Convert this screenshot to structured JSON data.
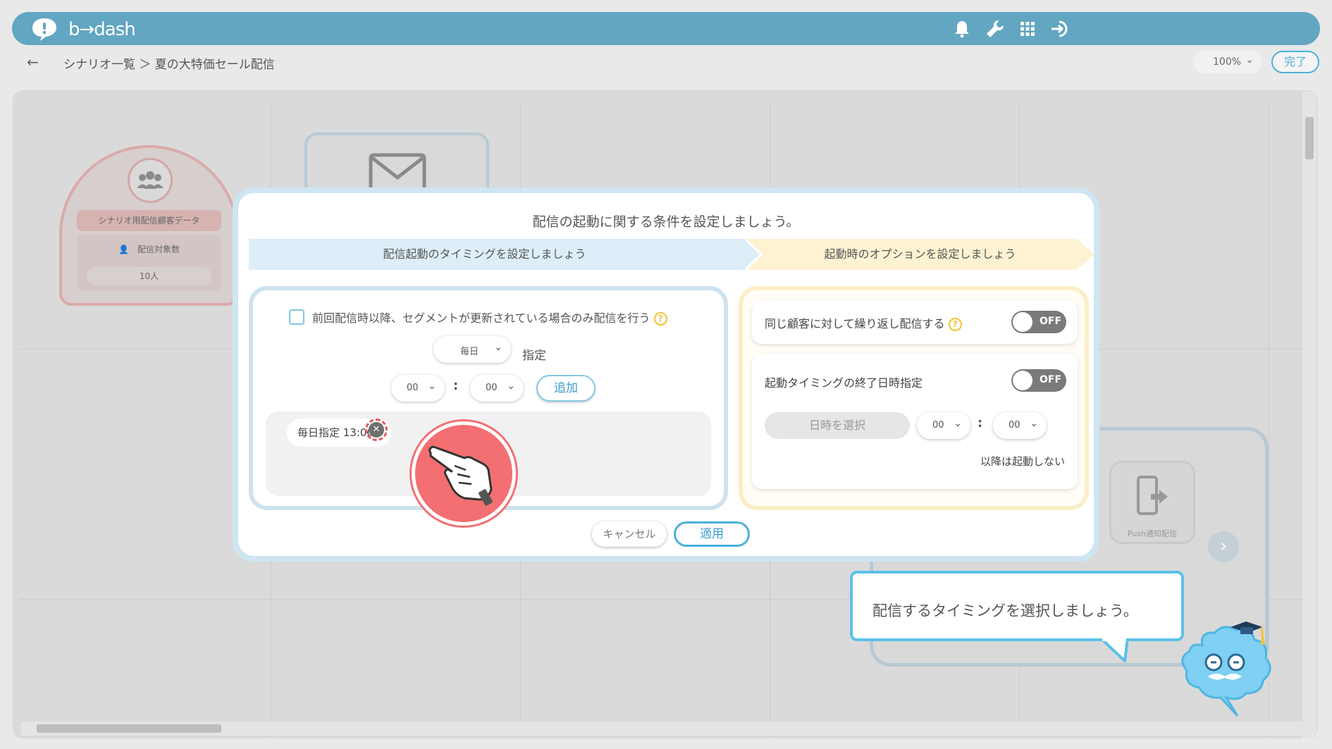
{
  "header": {
    "logo_text": "b→dash",
    "icons": [
      "bell-icon",
      "wrench-icon",
      "grid-icon",
      "logout-icon"
    ]
  },
  "breadcrumb": {
    "back_icon": "←",
    "path": "シナリオ一覧 ＞ 夏の大特価セール配信"
  },
  "toolbar": {
    "zoom": "100%",
    "done_label": "完了"
  },
  "canvas": {
    "start_node": {
      "title": "シナリオ用配信顧客データ",
      "count_label": "配信対象数",
      "count_value": "10人"
    },
    "push_node_label": "Push通知配信"
  },
  "modal": {
    "title": "配信の起動に関する条件を設定しましょう。",
    "steps": [
      "配信起動のタイミングを設定しましょう",
      "起動時のオプションを設定しましょう"
    ],
    "timing": {
      "checkbox_label": "前回配信時以降、セグメントが更新されている場合のみ配信を行う",
      "checkbox_checked": false,
      "frequency": "毎日",
      "frequency_suffix": "指定",
      "hour": "00",
      "minute": "00",
      "add_label": "追加",
      "entries": [
        "毎日指定 13:00"
      ]
    },
    "options": {
      "repeat_label": "同じ顧客に対して繰り返し配信する",
      "repeat_toggle": "OFF",
      "end_label": "起動タイミングの終了日時指定",
      "end_toggle": "OFF",
      "date_placeholder": "日時を選択",
      "end_hour": "00",
      "end_minute": "00",
      "after_text": "以降は起動しない"
    },
    "cancel_label": "キャンセル",
    "apply_label": "適用"
  },
  "tooltip": {
    "text": "配信するタイミングを選択しましょう。"
  },
  "colors": {
    "header": "#62a6c1",
    "accent": "#4cb1d8",
    "step_active": "#deeef8",
    "step_next": "#fdf3d3",
    "hand_highlight": "#f36f72"
  }
}
